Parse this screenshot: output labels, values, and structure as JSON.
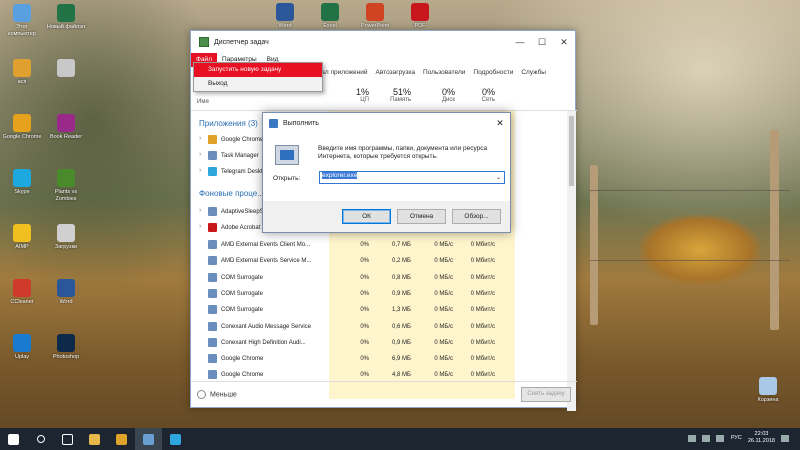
{
  "desktop": {
    "left_icons": [
      {
        "label": "Этот компьютер",
        "color": "#5aa0e0"
      },
      {
        "label": "Новый файлэл",
        "color": "#217346"
      },
      {
        "label": "ася",
        "color": "#e0a030"
      },
      {
        "label": "",
        "color": "#c8c8c8"
      },
      {
        "label": "Google Chrome",
        "color": "#e6a21c"
      },
      {
        "label": "Book Reader",
        "color": "#9a2a8a"
      },
      {
        "label": "Skype",
        "color": "#1ea8e0"
      },
      {
        "label": "Plants vs Zombies",
        "color": "#4a8a2a"
      },
      {
        "label": "AIMP",
        "color": "#f0c020"
      },
      {
        "label": "Загрузки",
        "color": "#d0d0d0"
      },
      {
        "label": "CCleaner",
        "color": "#d03a2a"
      },
      {
        "label": "Word",
        "color": "#2b579a"
      },
      {
        "label": "Uplay",
        "color": "#1a7ad0"
      },
      {
        "label": "Photoshop",
        "color": "#0e2a4a"
      }
    ],
    "top_icons": [
      {
        "label": "Word",
        "color": "#2b579a"
      },
      {
        "label": "Excel",
        "color": "#217346"
      },
      {
        "label": "PowerPoint",
        "color": "#d04423"
      },
      {
        "label": "PDF",
        "color": "#c8181e"
      }
    ],
    "recycle_bin": {
      "label": "Корзина",
      "color": "#a9c7e6"
    }
  },
  "task_manager": {
    "title": "Диспетчер задач",
    "window_buttons": [
      "—",
      "☐",
      "✕"
    ],
    "menu": [
      "Файл",
      "Параметры",
      "Вид"
    ],
    "file_menu_items": [
      "Запустить новую задачу",
      "Выход"
    ],
    "tabs": [
      "Журнал приложений",
      "Автозагрузка",
      "Пользователи",
      "Подробности",
      "Службы"
    ],
    "columns": [
      {
        "label": "Имя",
        "value": ""
      },
      {
        "label": "ЦП",
        "value": "1%"
      },
      {
        "label": "Память",
        "value": "51%"
      },
      {
        "label": "Диск",
        "value": "0%"
      },
      {
        "label": "Сеть",
        "value": "0%"
      }
    ],
    "sections": {
      "apps": "Приложения (3)",
      "background": "Фоновые проце..."
    },
    "app_rows": [
      "Google Chrome",
      "Task Manager",
      "Telegram Desktop"
    ],
    "bg_rows_partial": [
      "AdaptiveSleepService",
      "Adobe Acrobat"
    ],
    "rows": [
      {
        "name": "AMD External Events Client Mo...",
        "cpu": "0%",
        "mem": "0,7 МБ",
        "disk": "0 МБ/с",
        "net": "0 Мбит/с"
      },
      {
        "name": "AMD External Events Service M...",
        "cpu": "0%",
        "mem": "0,2 МБ",
        "disk": "0 МБ/с",
        "net": "0 Мбит/с"
      },
      {
        "name": "COM Surrogate",
        "cpu": "0%",
        "mem": "0,8 МБ",
        "disk": "0 МБ/с",
        "net": "0 Мбит/с"
      },
      {
        "name": "COM Surrogate",
        "cpu": "0%",
        "mem": "0,9 МБ",
        "disk": "0 МБ/с",
        "net": "0 Мбит/с"
      },
      {
        "name": "COM Surrogate",
        "cpu": "0%",
        "mem": "1,3 МБ",
        "disk": "0 МБ/с",
        "net": "0 Мбит/с"
      },
      {
        "name": "Conexant Audio Message Service",
        "cpu": "0%",
        "mem": "0,6 МБ",
        "disk": "0 МБ/с",
        "net": "0 Мбит/с"
      },
      {
        "name": "Conexant High Definition Audi...",
        "cpu": "0%",
        "mem": "0,9 МБ",
        "disk": "0 МБ/с",
        "net": "0 Мбит/с"
      },
      {
        "name": "Google Chrome",
        "cpu": "0%",
        "mem": "6,9 МБ",
        "disk": "0 МБ/с",
        "net": "0 Мбит/с"
      },
      {
        "name": "Google Chrome",
        "cpu": "0%",
        "mem": "4,8 МБ",
        "disk": "0 МБ/с",
        "net": "0 Мбит/с"
      }
    ],
    "footer_less": "Меньше",
    "footer_end_task": "Снять задачу"
  },
  "run_dialog": {
    "title": "Выполнить",
    "description": "Введите имя программы, папки, документа или ресурса Интернета, которые требуется открыть.",
    "open_label": "Открыть:",
    "input_value": "explorer.exe",
    "ok": "ОК",
    "cancel": "Отмена",
    "browse": "Обзор..."
  },
  "taskbar": {
    "lang": "РУС",
    "time": "22:03",
    "date": "26.11.2018",
    "apps": [
      {
        "name": "start-icon",
        "color": "#ffffff"
      },
      {
        "name": "search-icon",
        "color": "#ffffff"
      },
      {
        "name": "task-view-icon",
        "color": "#ffffff"
      },
      {
        "name": "file-explorer-icon",
        "color": "#e8b84a"
      },
      {
        "name": "chrome-icon",
        "color": "#e0a32a"
      },
      {
        "name": "task-manager-icon",
        "color": "#6a9fd4"
      },
      {
        "name": "telegram-icon",
        "color": "#2ea6de"
      }
    ]
  }
}
